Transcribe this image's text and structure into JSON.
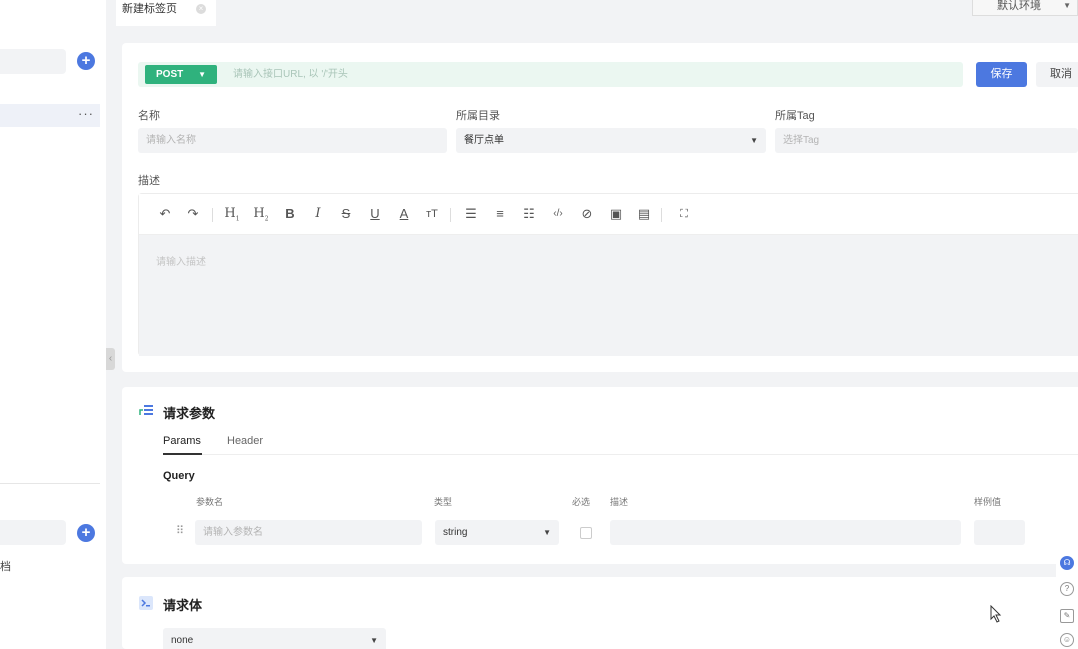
{
  "tab": {
    "label": "新建标签页"
  },
  "env": {
    "label": "默认环境"
  },
  "request": {
    "method": "POST",
    "url_placeholder": "请输入接口URL, 以 '/'开头",
    "save_label": "保存",
    "cancel_label": "取消"
  },
  "form": {
    "name_label": "名称",
    "name_placeholder": "请输入名称",
    "dir_label": "所属目录",
    "dir_value": "餐厅点单",
    "tag_label": "所属Tag",
    "tag_placeholder": "选择Tag",
    "desc_label": "描述",
    "desc_placeholder": "请输入描述"
  },
  "toolbar_icons": [
    "undo-icon",
    "redo-icon",
    "heading-1-icon",
    "heading-2-icon",
    "bold-icon",
    "italic-icon",
    "strikethrough-icon",
    "underline-icon",
    "font-color-icon",
    "font-size-icon",
    "bullet-list-icon",
    "ordered-list-icon",
    "task-list-icon",
    "code-icon",
    "link-icon",
    "image-icon",
    "table-icon",
    "fullscreen-icon"
  ],
  "params": {
    "title": "请求参数",
    "tabs": [
      "Params",
      "Header"
    ],
    "query_label": "Query",
    "columns": {
      "name": "参数名",
      "type": "类型",
      "required": "必选",
      "desc": "描述",
      "example": "样例值"
    },
    "row": {
      "name_placeholder": "请输入参数名",
      "type_value": "string"
    }
  },
  "body": {
    "title": "请求体",
    "type_value": "none"
  },
  "sidebar": {
    "doc_label": "档"
  },
  "colors": {
    "primary": "#4c78e0",
    "method_green": "#2fb27d",
    "url_bg": "#ebf7f1"
  }
}
